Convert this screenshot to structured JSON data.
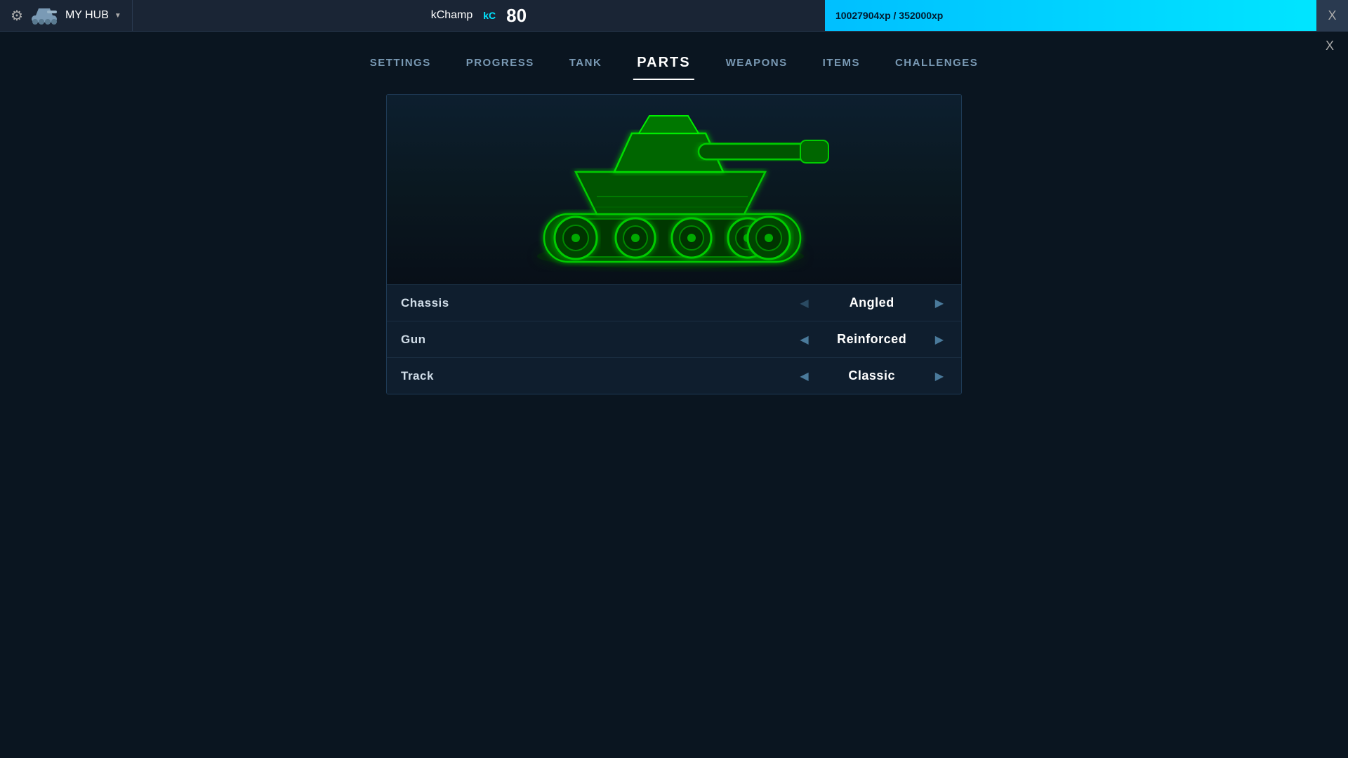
{
  "topbar": {
    "hub_label": "MY HUB",
    "username": "kChamp",
    "kc_badge": "kC",
    "level": "80",
    "xp_text": "10027904xp / 352000xp",
    "close_label": "X"
  },
  "nav": {
    "items": [
      {
        "id": "settings",
        "label": "SETTINGS",
        "active": false
      },
      {
        "id": "progress",
        "label": "PROGRESS",
        "active": false
      },
      {
        "id": "tank",
        "label": "TANK",
        "active": false
      },
      {
        "id": "parts",
        "label": "PARTS",
        "active": true
      },
      {
        "id": "weapons",
        "label": "WEAPONS",
        "active": false
      },
      {
        "id": "items",
        "label": "ITEMS",
        "active": false
      },
      {
        "id": "challenges",
        "label": "CHALLENGES",
        "active": false
      }
    ]
  },
  "parts": {
    "rows": [
      {
        "id": "chassis",
        "label": "Chassis",
        "value": "Angled",
        "has_left": false,
        "has_right": true
      },
      {
        "id": "gun",
        "label": "Gun",
        "value": "Reinforced",
        "has_left": true,
        "has_right": true
      },
      {
        "id": "track",
        "label": "Track",
        "value": "Classic",
        "has_left": true,
        "has_right": true
      }
    ]
  },
  "icons": {
    "gear": "⚙",
    "chevron_down": "▼",
    "arrow_left": "◀",
    "arrow_right": "▶"
  }
}
